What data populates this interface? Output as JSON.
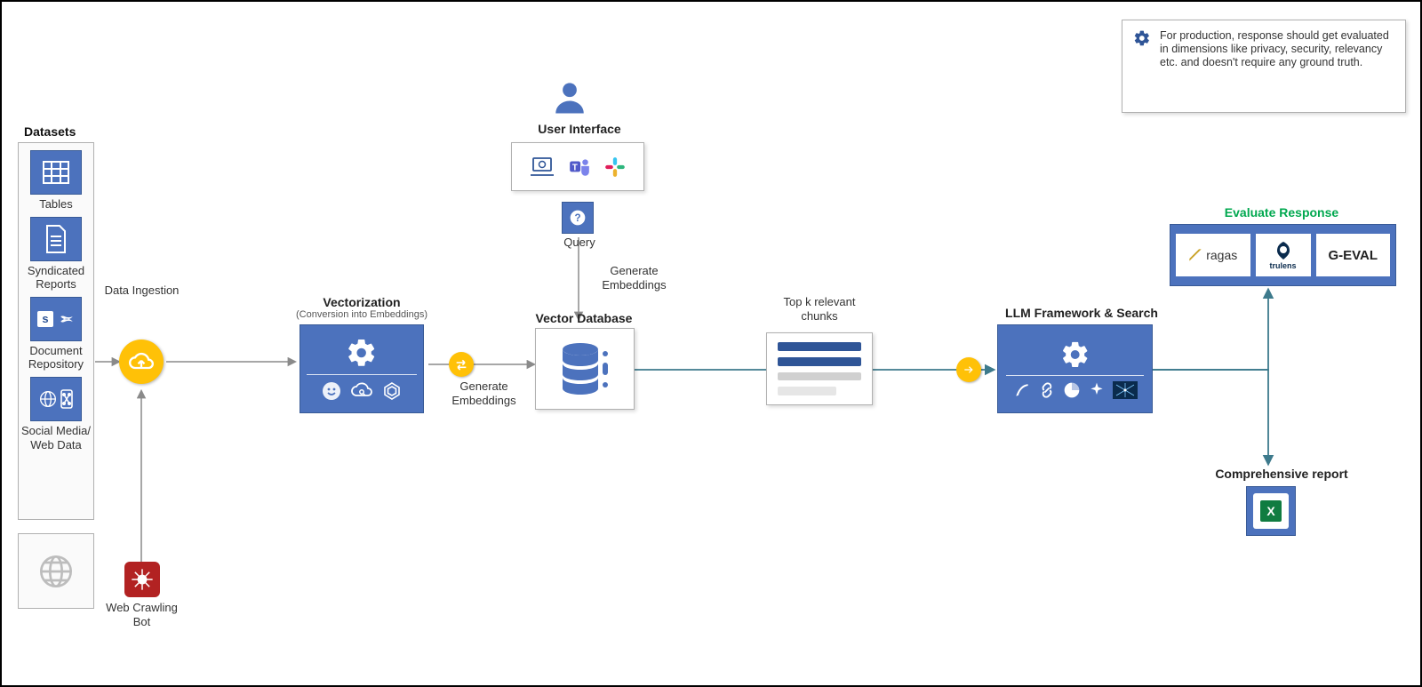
{
  "datasets": {
    "header": "Datasets",
    "items": [
      {
        "label": "Tables"
      },
      {
        "label": "Syndicated Reports"
      },
      {
        "label": "Document Repository"
      },
      {
        "label": "Social Media/ Web Data"
      }
    ]
  },
  "web_crawler": {
    "label": "Web Crawling Bot"
  },
  "ingestion": {
    "label": "Data Ingestion"
  },
  "vectorization": {
    "title": "Vectorization",
    "subtitle": "(Conversion into Embeddings)"
  },
  "embed_left": {
    "label": "Generate Embeddings"
  },
  "embed_top": {
    "label": "Generate Embeddings"
  },
  "user_if": {
    "label": "User Interface"
  },
  "query": {
    "label": "Query"
  },
  "vector_db": {
    "title": "Vector Database"
  },
  "topk": {
    "label": "Top k relevant chunks"
  },
  "llm": {
    "title": "LLM Framework & Search"
  },
  "evaluate": {
    "title": "Evaluate Response",
    "tools": [
      "ragas",
      "trulens",
      "G-EVAL"
    ]
  },
  "report": {
    "title": "Comprehensive report"
  },
  "note": {
    "text": "For production, response should get evaluated in dimensions like privacy, security, relevancy etc. and doesn't require any ground truth."
  },
  "colors": {
    "blue": "#4c72bd",
    "dark_blue": "#2f5597",
    "yellow": "#ffc107",
    "green": "#00a84f"
  }
}
